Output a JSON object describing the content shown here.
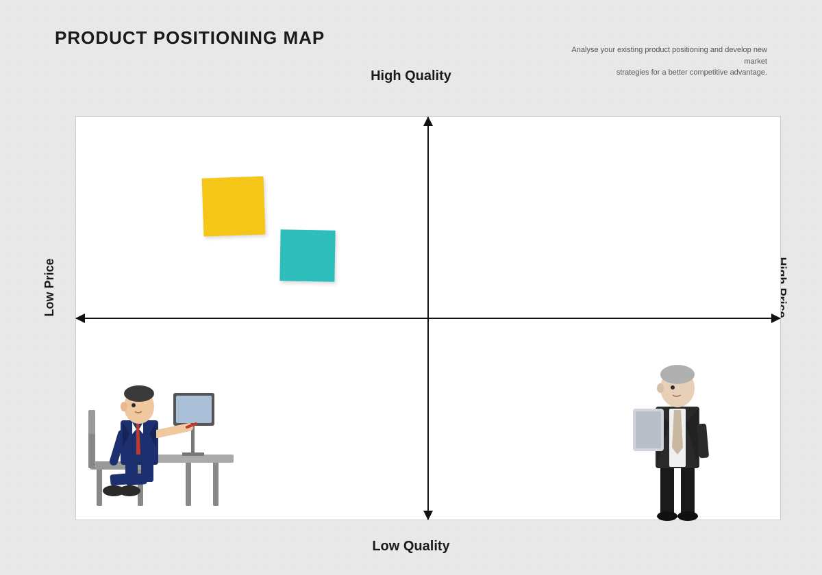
{
  "title": "PRODUCT POSITIONING MAP",
  "subtitle_line1": "Analyse your existing product positioning and develop new market",
  "subtitle_line2": "strategies for a better competitive advantage.",
  "labels": {
    "high_quality": "High Quality",
    "low_quality": "Low Quality",
    "low_price": "Low Price",
    "high_price": "High Price"
  },
  "sticky_notes": [
    {
      "color": "#f5c518",
      "name": "yellow-sticky"
    },
    {
      "color": "#2dbdba",
      "name": "teal-sticky"
    }
  ],
  "colors": {
    "background": "#e8e8e8",
    "chart_bg": "#ffffff",
    "axis": "#111111",
    "title": "#1a1a1a"
  }
}
